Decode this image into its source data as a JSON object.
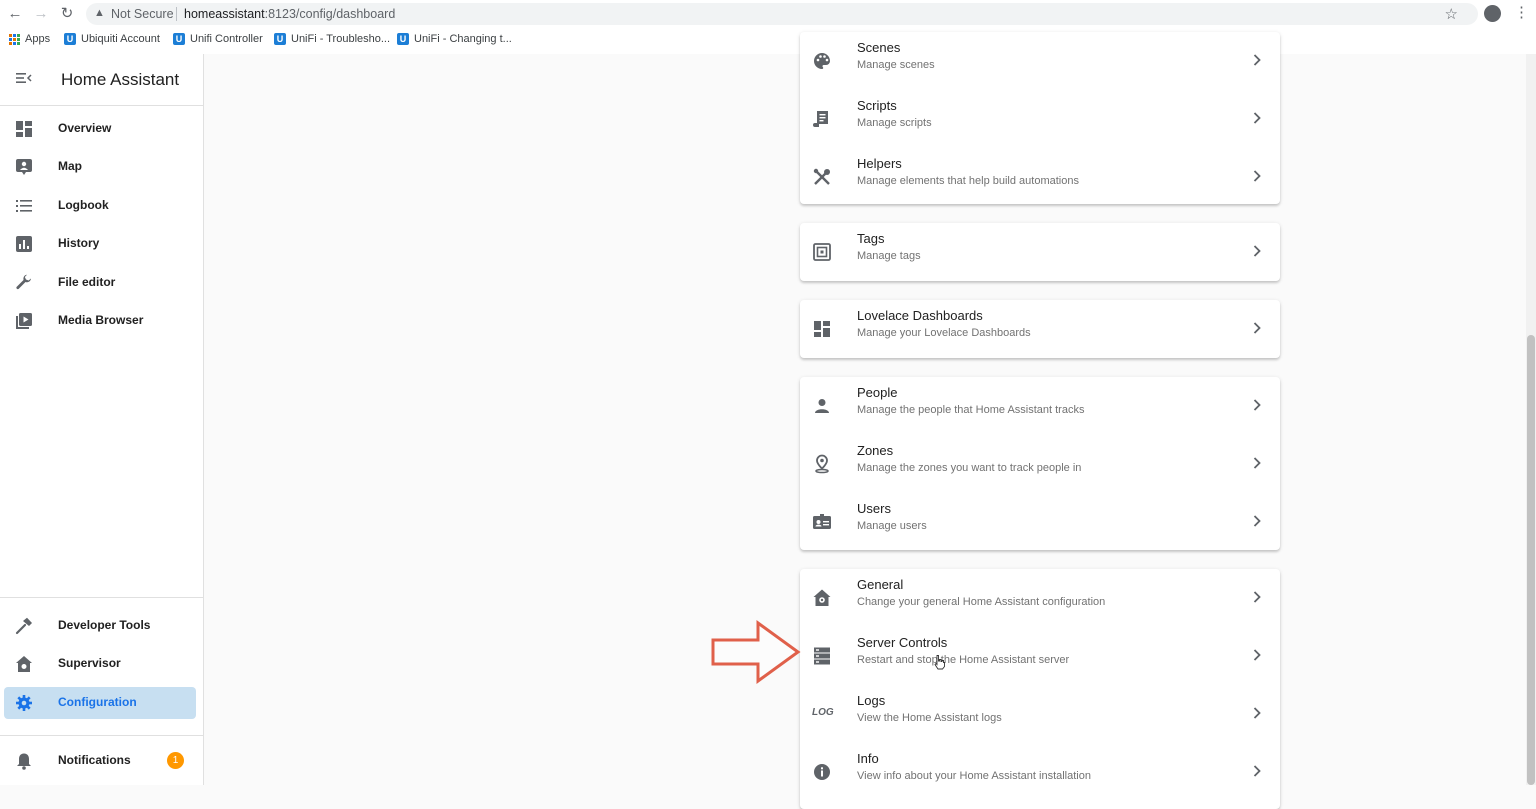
{
  "browser": {
    "security_label": "Not Secure",
    "url_host": "homeassistant",
    "url_rest": ":8123/config/dashboard",
    "bookmarks": [
      {
        "label": "Apps"
      },
      {
        "label": "Ubiquiti Account"
      },
      {
        "label": "Unifi Controller"
      },
      {
        "label": "UniFi - Troublesho..."
      },
      {
        "label": "UniFi - Changing t..."
      }
    ]
  },
  "sidebar": {
    "title": "Home Assistant",
    "items": [
      {
        "label": "Overview",
        "icon": "dashboard-icon"
      },
      {
        "label": "Map",
        "icon": "map-icon"
      },
      {
        "label": "Logbook",
        "icon": "list-icon"
      },
      {
        "label": "History",
        "icon": "chart-icon"
      },
      {
        "label": "File editor",
        "icon": "wrench-icon"
      },
      {
        "label": "Media Browser",
        "icon": "media-icon"
      }
    ],
    "bottom_items": [
      {
        "label": "Developer Tools",
        "icon": "hammer-icon"
      },
      {
        "label": "Supervisor",
        "icon": "supervisor-icon"
      },
      {
        "label": "Configuration",
        "icon": "gear-icon",
        "active": true
      }
    ],
    "notifications": {
      "label": "Notifications",
      "count": "1"
    }
  },
  "config": {
    "group1": [
      {
        "title": "Scenes",
        "subtitle": "Manage scenes",
        "icon": "palette-icon"
      },
      {
        "title": "Scripts",
        "subtitle": "Manage scripts",
        "icon": "script-icon"
      },
      {
        "title": "Helpers",
        "subtitle": "Manage elements that help build automations",
        "icon": "tools-icon"
      }
    ],
    "group2": [
      {
        "title": "Tags",
        "subtitle": "Manage tags",
        "icon": "nfc-icon"
      }
    ],
    "group3": [
      {
        "title": "Lovelace Dashboards",
        "subtitle": "Manage your Lovelace Dashboards",
        "icon": "dashboard-icon"
      }
    ],
    "group4": [
      {
        "title": "People",
        "subtitle": "Manage the people that Home Assistant tracks",
        "icon": "person-icon"
      },
      {
        "title": "Zones",
        "subtitle": "Manage the zones you want to track people in",
        "icon": "map-marker-icon"
      },
      {
        "title": "Users",
        "subtitle": "Manage users",
        "icon": "badge-icon"
      }
    ],
    "group5": [
      {
        "title": "General",
        "subtitle": "Change your general Home Assistant configuration",
        "icon": "home-gear-icon"
      },
      {
        "title": "Server Controls",
        "subtitle": "Restart and stop the Home Assistant server",
        "icon": "server-icon"
      },
      {
        "title": "Logs",
        "subtitle": "View the Home Assistant logs",
        "icon": "logs-icon"
      },
      {
        "title": "Info",
        "subtitle": "View info about your Home Assistant installation",
        "icon": "info-icon"
      }
    ]
  },
  "colors": {
    "accent": "#1a73e8",
    "active_bg": "#c7dff1",
    "badge": "#ff9800",
    "annotation_arrow": "#e0604a"
  }
}
